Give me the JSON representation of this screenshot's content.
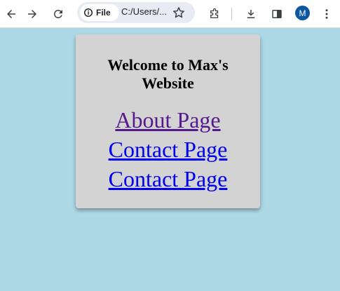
{
  "browser": {
    "site_info_label": "File",
    "url": "C:/Users/...",
    "avatar_letter": "M",
    "accent": "#0b57a0"
  },
  "page": {
    "background": "#add8e6",
    "card_background": "#d3d3d3",
    "heading": "Welcome to Max's Website",
    "links": [
      {
        "label": "About Page",
        "state": "visited",
        "color": "#551a8b"
      },
      {
        "label": "Contact Page",
        "state": "unvisited",
        "color": "#0000ee"
      },
      {
        "label": "Contact Page",
        "state": "unvisited",
        "color": "#0000ee"
      }
    ]
  }
}
